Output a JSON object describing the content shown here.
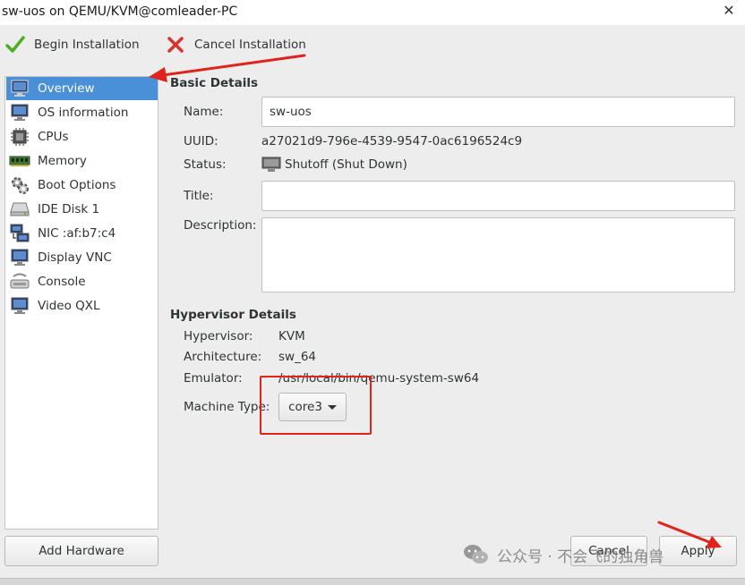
{
  "window": {
    "title": "sw-uos on QEMU/KVM@comleader-PC",
    "close_glyph": "✕"
  },
  "toolbar": {
    "begin_label": "Begin Installation",
    "cancel_label": "Cancel Installation"
  },
  "sidebar": {
    "items": [
      {
        "label": "Overview",
        "icon": "monitor-icon",
        "selected": true
      },
      {
        "label": "OS information",
        "icon": "monitor-icon"
      },
      {
        "label": "CPUs",
        "icon": "cpu-icon"
      },
      {
        "label": "Memory",
        "icon": "memory-icon"
      },
      {
        "label": "Boot Options",
        "icon": "gears-icon"
      },
      {
        "label": "IDE Disk 1",
        "icon": "disk-icon"
      },
      {
        "label": "NIC :af:b7:c4",
        "icon": "network-icon"
      },
      {
        "label": "Display VNC",
        "icon": "monitor-icon"
      },
      {
        "label": "Console",
        "icon": "console-icon"
      },
      {
        "label": "Video QXL",
        "icon": "monitor-icon"
      }
    ],
    "add_hardware_label": "Add Hardware"
  },
  "basic": {
    "section_title": "Basic Details",
    "name_label": "Name:",
    "name_value": "sw-uos",
    "uuid_label": "UUID:",
    "uuid_value": "a27021d9-796e-4539-9547-0ac6196524c9",
    "status_label": "Status:",
    "status_value": "Shutoff (Shut Down)",
    "title_label": "Title:",
    "title_value": "",
    "description_label": "Description:",
    "description_value": ""
  },
  "hypervisor": {
    "section_title": "Hypervisor Details",
    "hypervisor_label": "Hypervisor:",
    "hypervisor_value": "KVM",
    "architecture_label": "Architecture:",
    "architecture_value": "sw_64",
    "emulator_label": "Emulator:",
    "emulator_value": "/usr/local/bin/qemu-system-sw64",
    "machine_type_label": "Machine Type:",
    "machine_type_value": "core3"
  },
  "buttons": {
    "cancel_label": "Cancel",
    "apply_label": "Apply"
  },
  "watermark": {
    "text": "公众号 · 不会飞的独角兽"
  },
  "colors": {
    "selection": "#4a90d9",
    "annotation_red": "#e0241b",
    "check_green": "#4caf26"
  }
}
